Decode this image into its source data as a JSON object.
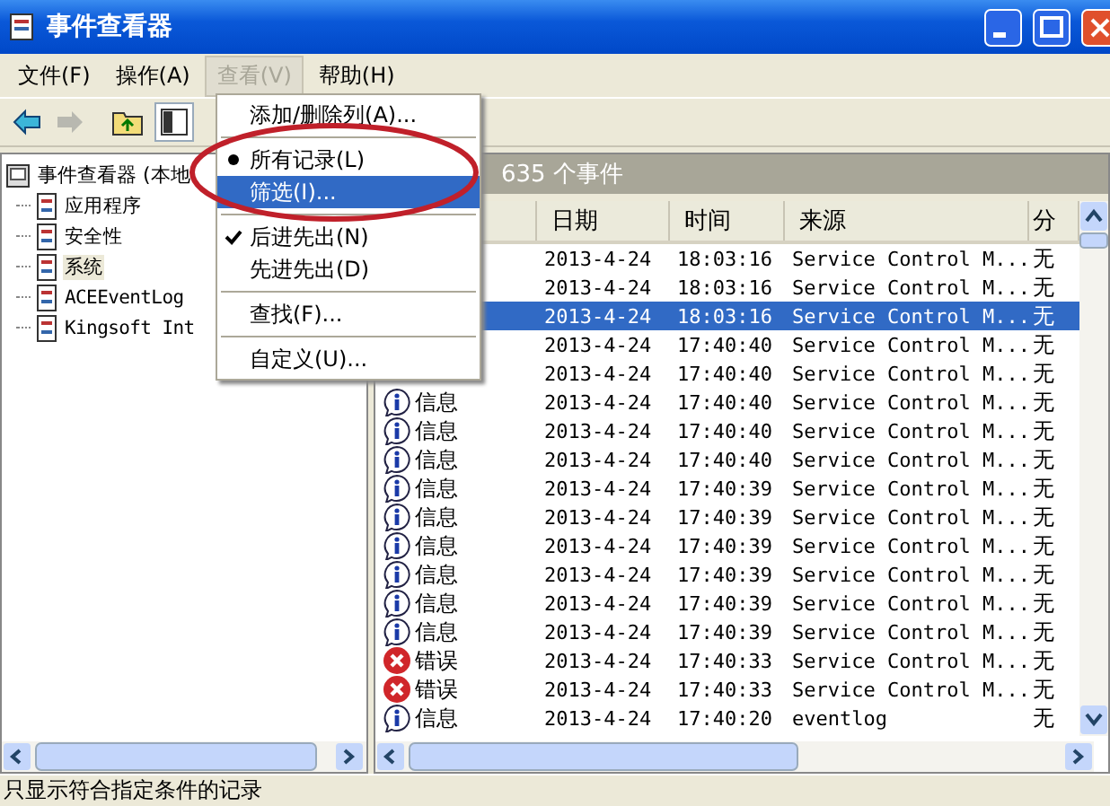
{
  "window": {
    "title": "事件查看器"
  },
  "menu_bar": [
    {
      "label": "文件(F)",
      "selected": false
    },
    {
      "label": "操作(A)",
      "selected": false
    },
    {
      "label": "查看(V)",
      "selected": true
    },
    {
      "label": "帮助(H)",
      "selected": false
    }
  ],
  "toolbar": [
    {
      "kind": "back",
      "disabled": false
    },
    {
      "kind": "forward",
      "disabled": true
    },
    {
      "kind": "up",
      "disabled": false
    },
    {
      "kind": "tree",
      "disabled": false
    }
  ],
  "tree": {
    "label": "事件查看器 (本地",
    "children": [
      {
        "label": "应用程序",
        "selected": false
      },
      {
        "label": "安全性",
        "selected": false
      },
      {
        "label": "系统",
        "selected": true
      },
      {
        "label": "ACEEventLog",
        "selected": false
      },
      {
        "label": "Kingsoft Int",
        "selected": false
      }
    ]
  },
  "events_header": "635 个事件",
  "table": {
    "columns": [
      "日期",
      "时间",
      "来源",
      "分"
    ],
    "rows": [
      {
        "date": "2013-4-24",
        "time": "18:03:16",
        "source": "Service Control M...",
        "column_5": "无",
        "selected": false
      },
      {
        "date": "2013-4-24",
        "time": "18:03:16",
        "source": "Service Control M...",
        "column_5": "无",
        "selected": false
      },
      {
        "date": "2013-4-24",
        "time": "18:03:16",
        "source": "Service Control M...",
        "column_5": "无",
        "selected": true
      },
      {
        "date": "2013-4-24",
        "time": "17:40:40",
        "source": "Service Control M...",
        "column_5": "无",
        "selected": false
      },
      {
        "date": "2013-4-24",
        "time": "17:40:40",
        "source": "Service Control M...",
        "column_5": "无",
        "selected": false
      },
      {
        "kind": "info",
        "type": "信息",
        "date": "2013-4-24",
        "time": "17:40:40",
        "source": "Service Control M...",
        "column_5": "无",
        "selected": false
      },
      {
        "kind": "info",
        "type": "信息",
        "date": "2013-4-24",
        "time": "17:40:40",
        "source": "Service Control M...",
        "column_5": "无",
        "selected": false
      },
      {
        "kind": "info",
        "type": "信息",
        "date": "2013-4-24",
        "time": "17:40:40",
        "source": "Service Control M...",
        "column_5": "无",
        "selected": false
      },
      {
        "kind": "info",
        "type": "信息",
        "date": "2013-4-24",
        "time": "17:40:39",
        "source": "Service Control M...",
        "column_5": "无",
        "selected": false
      },
      {
        "kind": "info",
        "type": "信息",
        "date": "2013-4-24",
        "time": "17:40:39",
        "source": "Service Control M...",
        "column_5": "无",
        "selected": false
      },
      {
        "kind": "info",
        "type": "信息",
        "date": "2013-4-24",
        "time": "17:40:39",
        "source": "Service Control M...",
        "column_5": "无",
        "selected": false
      },
      {
        "kind": "info",
        "type": "信息",
        "date": "2013-4-24",
        "time": "17:40:39",
        "source": "Service Control M...",
        "column_5": "无",
        "selected": false
      },
      {
        "kind": "info",
        "type": "信息",
        "date": "2013-4-24",
        "time": "17:40:39",
        "source": "Service Control M...",
        "column_5": "无",
        "selected": false
      },
      {
        "kind": "info",
        "type": "信息",
        "date": "2013-4-24",
        "time": "17:40:39",
        "source": "Service Control M...",
        "column_5": "无",
        "selected": false
      },
      {
        "kind": "error",
        "type": "错误",
        "date": "2013-4-24",
        "time": "17:40:33",
        "source": "Service Control M...",
        "column_5": "无",
        "selected": false
      },
      {
        "kind": "error",
        "type": "错误",
        "date": "2013-4-24",
        "time": "17:40:33",
        "source": "Service Control M...",
        "column_5": "无",
        "selected": false
      },
      {
        "kind": "info",
        "type": "信息",
        "date": "2013-4-24",
        "time": "17:40:20",
        "source": "eventlog",
        "column_5": "无",
        "selected": false
      }
    ]
  },
  "view_menu": [
    {
      "kind": "item",
      "label": "添加/删除列(A)...",
      "selected": false
    },
    {
      "kind": "separator"
    },
    {
      "kind": "radio",
      "label": "所有记录(L)",
      "checked": true,
      "selected": false
    },
    {
      "kind": "radio",
      "label": "筛选(I)...",
      "checked": false,
      "selected": true
    },
    {
      "kind": "separator"
    },
    {
      "kind": "check",
      "label": "后进先出(N)",
      "checked": true,
      "selected": false
    },
    {
      "kind": "check",
      "label": "先进先出(D)",
      "checked": false,
      "selected": false
    },
    {
      "kind": "separator"
    },
    {
      "kind": "item",
      "label": "查找(F)...",
      "selected": false
    },
    {
      "kind": "separator"
    },
    {
      "kind": "item",
      "label": "自定义(U)...",
      "selected": false
    }
  ],
  "status_bar": "只显示符合指定条件的记录"
}
